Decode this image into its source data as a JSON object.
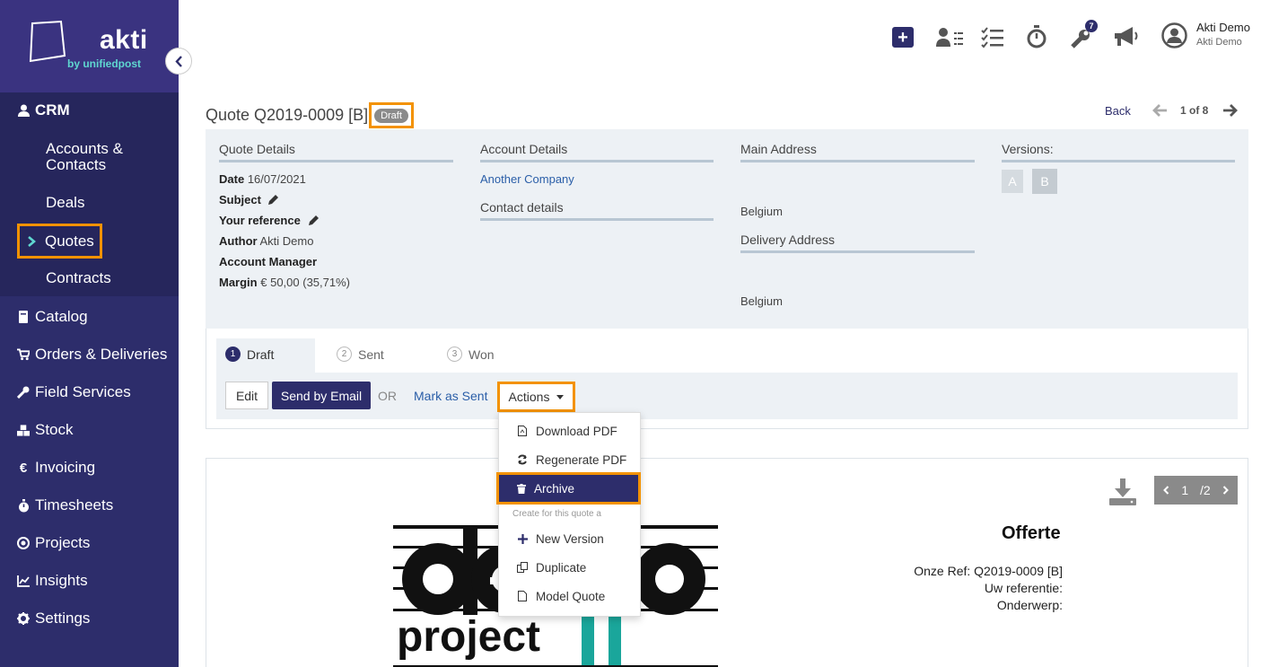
{
  "brand": {
    "name": "akti",
    "sub": "by unifiedpost"
  },
  "sidebar": {
    "section": "CRM",
    "crm_items": [
      "Accounts &",
      "Contacts",
      "Deals",
      "Quotes",
      "Contracts"
    ],
    "items": [
      "Catalog",
      "Orders & Deliveries",
      "Field Services",
      "Stock",
      "Invoicing",
      "Timesheets",
      "Projects",
      "Insights",
      "Settings"
    ]
  },
  "topbar": {
    "badge": "7",
    "user_name": "Akti Demo",
    "user_company": "Akti Demo"
  },
  "header": {
    "title": "Quote Q2019-0009 [B]",
    "status": "Draft",
    "back": "Back",
    "pager": "1 of 8"
  },
  "details": {
    "quote_details_h": "Quote Details",
    "date_label": "Date",
    "date_value": "16/07/2021",
    "subject_label": "Subject",
    "reference_label": "Your reference",
    "author_label": "Author",
    "author_value": "Akti Demo",
    "manager_label": "Account Manager",
    "margin_label": "Margin",
    "margin_value": "€ 50,00 (35,71%)",
    "account_details_h": "Account Details",
    "account_name": "Another Company",
    "contact_details_h": "Contact details",
    "main_address_h": "Main Address",
    "main_country": "Belgium",
    "delivery_address_h": "Delivery Address",
    "delivery_country": "Belgium",
    "versions_h": "Versions:",
    "versions": [
      "A",
      "B"
    ]
  },
  "steps": [
    {
      "n": "1",
      "label": "Draft"
    },
    {
      "n": "2",
      "label": "Sent"
    },
    {
      "n": "3",
      "label": "Won"
    }
  ],
  "toolbar": {
    "edit": "Edit",
    "send": "Send by Email",
    "or": "OR",
    "mark_sent": "Mark as Sent",
    "actions": "Actions"
  },
  "dropdown": {
    "download": "Download PDF",
    "regenerate": "Regenerate PDF",
    "archive": "Archive",
    "caption": "Create for this quote a",
    "new_version": "New Version",
    "duplicate": "Duplicate",
    "model": "Model Quote"
  },
  "preview": {
    "page_current": "1",
    "page_total": "/2",
    "doc_title": "Offerte",
    "ref_line": "Onze Ref: Q2019-0009 [B]",
    "ref_label": "Uw referentie:",
    "subject_label": "Onderwerp:",
    "logo_word": "project"
  },
  "colors": {
    "primary": "#2d2d6b",
    "highlight": "#f39200",
    "teal": "#5fd7d0"
  }
}
